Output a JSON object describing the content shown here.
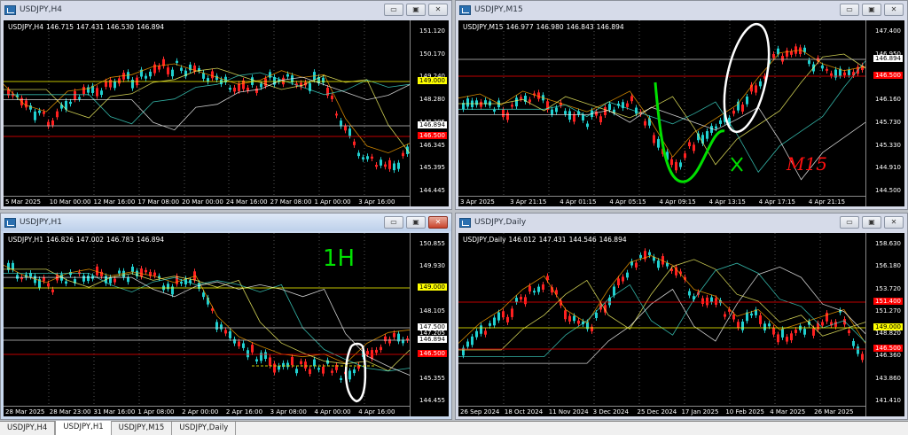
{
  "windows": [
    {
      "id": "h4",
      "title": "USDJPY,H4",
      "ohlc": {
        "symbol": "USDJPY,H4",
        "open": "146.715",
        "high": "147.431",
        "low": "146.530",
        "close": "146.894"
      },
      "price_labels": [
        "151.120",
        "150.170",
        "149.240",
        "148.280",
        "147.295",
        "146.345",
        "145.395",
        "144.445"
      ],
      "tags": [
        {
          "text": "149.000",
          "style": "yellow"
        },
        {
          "text": "146.894",
          "style": "white"
        },
        {
          "text": "146.500",
          "style": "red"
        }
      ],
      "time_labels": [
        "5 Mar 2025",
        "10 Mar 00:00",
        "12 Mar 16:00",
        "17 Mar 08:00",
        "20 Mar 00:00",
        "24 Mar 16:00",
        "27 Mar 08:00",
        "1 Apr 00:00",
        "3 Apr 16:00"
      ]
    },
    {
      "id": "m15",
      "title": "USDJPY,M15",
      "ohlc": {
        "symbol": "USDJPY,M15",
        "open": "146.977",
        "high": "146.980",
        "low": "146.843",
        "close": "146.894"
      },
      "price_labels": [
        "147.400",
        "146.950",
        "146.600",
        "146.160",
        "145.730",
        "145.330",
        "144.910",
        "144.500"
      ],
      "tags": [
        {
          "text": "146.894",
          "style": "white"
        },
        {
          "text": "146.500",
          "style": "red"
        }
      ],
      "time_labels": [
        "3 Apr 2025",
        "3 Apr 21:15",
        "4 Apr 01:15",
        "4 Apr 05:15",
        "4 Apr 09:15",
        "4 Apr 13:15",
        "4 Apr 17:15",
        "4 Apr 21:15"
      ],
      "handwriting": "M15"
    },
    {
      "id": "h1",
      "title": "USDJPY,H1",
      "ohlc": {
        "symbol": "USDJPY,H1",
        "open": "146.826",
        "high": "147.002",
        "low": "146.783",
        "close": "146.894"
      },
      "price_labels": [
        "150.855",
        "149.930",
        "149.000",
        "148.105",
        "147.205",
        "146.280",
        "145.355",
        "144.455"
      ],
      "tags": [
        {
          "text": "149.000",
          "style": "yellow"
        },
        {
          "text": "147.500",
          "style": "white"
        },
        {
          "text": "146.894",
          "style": "white"
        },
        {
          "text": "146.500",
          "style": "red"
        }
      ],
      "time_labels": [
        "28 Mar 2025",
        "28 Mar 23:00",
        "31 Mar 16:00",
        "1 Apr 08:00",
        "2 Apr 00:00",
        "2 Apr 16:00",
        "3 Apr 08:00",
        "4 Apr 00:00",
        "4 Apr 16:00"
      ],
      "handwriting": "1H"
    },
    {
      "id": "daily",
      "title": "USDJPY,Daily",
      "ohlc": {
        "symbol": "USDJPY,Daily",
        "open": "146.012",
        "high": "147.431",
        "low": "144.546",
        "close": "146.894"
      },
      "price_labels": [
        "158.630",
        "156.180",
        "153.720",
        "151.270",
        "148.820",
        "146.360",
        "143.860",
        "141.410"
      ],
      "tags": [
        {
          "text": "151.400",
          "style": "red"
        },
        {
          "text": "149.000",
          "style": "yellow"
        },
        {
          "text": "146.500",
          "style": "red"
        }
      ],
      "time_labels": [
        "26 Sep 2024",
        "18 Oct 2024",
        "11 Nov 2024",
        "3 Dec 2024",
        "25 Dec 2024",
        "17 Jan 2025",
        "10 Feb 2025",
        "4 Mar 2025",
        "26 Mar 2025"
      ]
    }
  ],
  "tabs": [
    "USDJPY,H4",
    "USDJPY,H1",
    "USDJPY,M15",
    "USDJPY,Daily"
  ],
  "active_tab": "USDJPY,H1",
  "window_buttons": {
    "minimize": "▭",
    "maximize": "▣",
    "close": "✕"
  },
  "colors": {
    "bull": "#ff0000",
    "bear": "#00c0c0",
    "yellow_line": "#ffff00",
    "red_line": "#ff0000",
    "annot_green": "#00e000",
    "annot_red": "#ff0000"
  }
}
